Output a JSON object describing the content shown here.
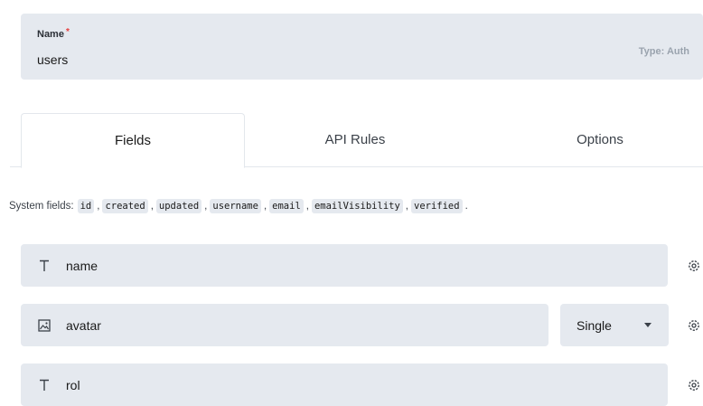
{
  "collection": {
    "name_label": "Name",
    "required_mark": "*",
    "name_value": "users",
    "type_text": "Type: Auth"
  },
  "tabs": [
    {
      "label": "Fields",
      "active": true
    },
    {
      "label": "API Rules",
      "active": false
    },
    {
      "label": "Options",
      "active": false
    }
  ],
  "system_fields": {
    "prefix": "System fields:",
    "items": [
      "id",
      "created",
      "updated",
      "username",
      "email",
      "emailVisibility",
      "verified"
    ],
    "separator": ",",
    "terminator": "."
  },
  "fields": [
    {
      "name": "name",
      "icon": "text-icon"
    },
    {
      "name": "avatar",
      "icon": "image-icon",
      "select_value": "Single"
    },
    {
      "name": "rol",
      "icon": "text-icon"
    }
  ],
  "colors": {
    "panel": "#e5e9ef",
    "required": "#e53e3e",
    "muted": "#9aa3ae"
  }
}
